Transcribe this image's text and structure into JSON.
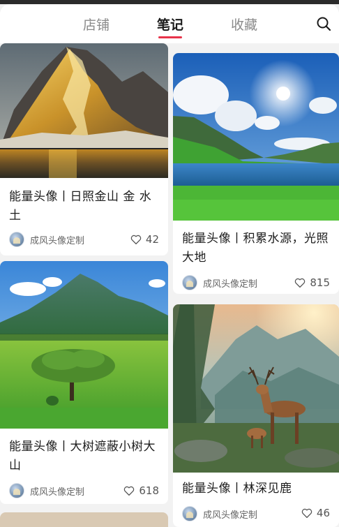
{
  "tabs": [
    {
      "label": "店铺"
    },
    {
      "label": "笔记"
    },
    {
      "label": "收藏"
    }
  ],
  "active_tab": "笔记",
  "accent_color": "#e8334a",
  "search_icon": "search-icon",
  "notes": [
    {
      "title": "能量头像丨日照金山 金 水土",
      "author": "成风头像定制",
      "likes": "42",
      "image": "golden-mountain-lake"
    },
    {
      "title": "能量头像丨积累水源，光照大地",
      "author": "成风头像定制",
      "likes": "815",
      "image": "sunny-valley-lake"
    },
    {
      "title": "能量头像丨大树遮蔽小树大山",
      "author": "成风头像定制",
      "likes": "618",
      "image": "big-tree-mountain"
    },
    {
      "title": "能量头像丨林深见鹿",
      "author": "成风头像定制",
      "likes": "46",
      "image": "deer-forest"
    }
  ]
}
